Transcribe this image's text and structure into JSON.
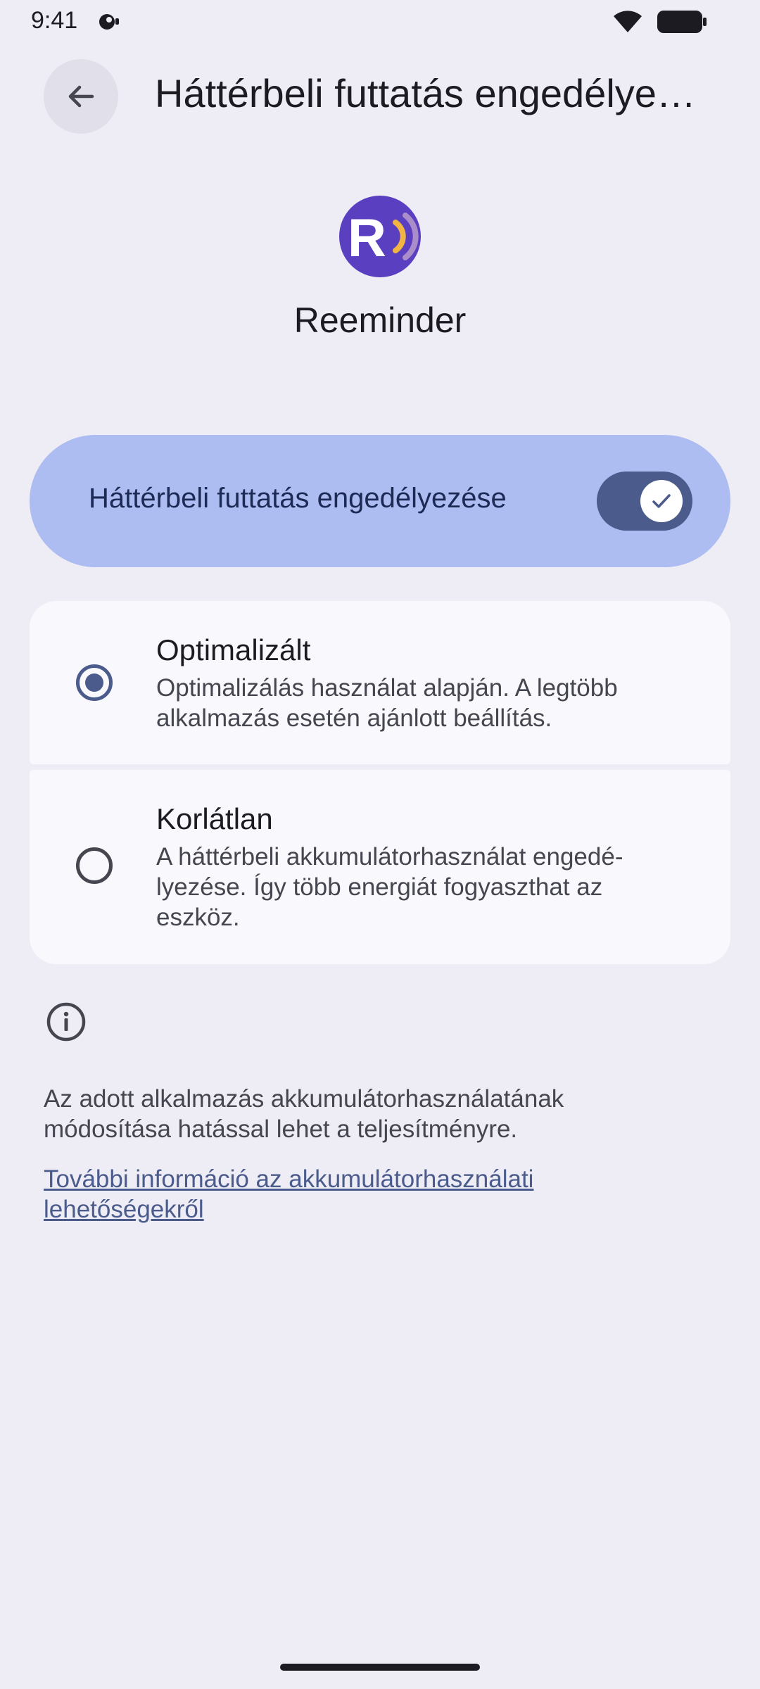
{
  "status_bar": {
    "time": "9:41",
    "icons": [
      "notification-icon",
      "wifi-icon",
      "battery-icon"
    ]
  },
  "top_bar": {
    "back_icon": "arrow-back-icon",
    "title": "Háttérbeli futtatás engedélyezése"
  },
  "app": {
    "name": "Reeminder",
    "icon": "reeminder-logo",
    "icon_colors": {
      "background": "#5a3fc0",
      "letter": "#ffffff",
      "wave_inner": "#f2b443",
      "wave_outer": "#a98ec9"
    }
  },
  "main_toggle": {
    "label": "Háttérbeli futtatás engedélyezése",
    "checked": true,
    "thumb_icon": "check-icon"
  },
  "options": [
    {
      "title": "Optimalizált",
      "description": "Optimalizálás használat alapján. A legtöbb alkalmazás esetén ajánlott beállítás.",
      "selected": true
    },
    {
      "title": "Korlátlan",
      "description": "A háttérbeli akkumulátorhasználat engedé-lyezése. Így több energiát fogyaszthat az eszköz.",
      "selected": false
    }
  ],
  "footer": {
    "info_icon": "info-icon",
    "text": "Az adott alkalmazás akkumulátorhasználatának módosítása hatással lehet a teljesítményre.",
    "link": "További információ az akkumulátorhasználati lehetőségekről"
  },
  "colors": {
    "background": "#eeedf6",
    "toggle_card": "#adbdf1",
    "switch_track": "#4a5b8c",
    "option_card": "#f9f8fd",
    "accent": "#4a5b8c"
  }
}
